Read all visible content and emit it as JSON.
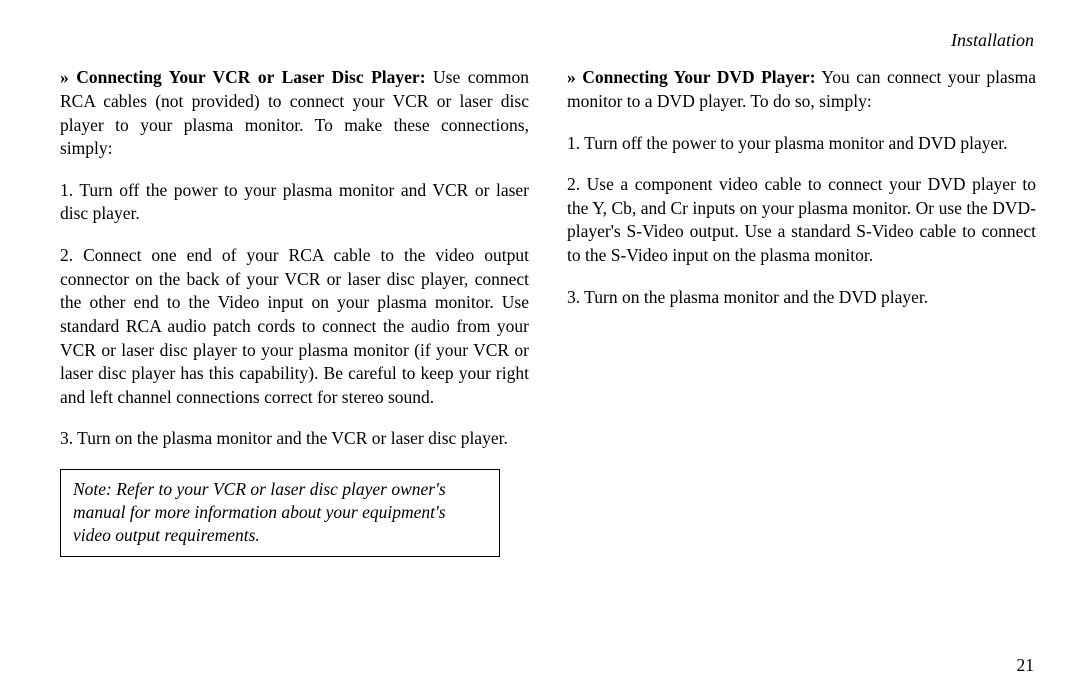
{
  "header": {
    "section": "Installation"
  },
  "left": {
    "heading": "» Connecting Your VCR or Laser Disc Player:",
    "intro": "Use common RCA cables (not provided) to connect your VCR or laser disc player to your plasma monitor. To make these connections, simply:",
    "step1": "1. Turn off the power to your plasma monitor and VCR or laser disc player.",
    "step2": "2. Connect one end of your RCA cable to the video output connector on the back of your VCR or laser disc player, connect the other end to the Video input on your plasma monitor.  Use standard  RCA  audio  patch  cords  to connect the audio from your VCR or laser disc player to your plasma monitor (if your VCR or laser disc player has this capability). Be careful to keep your right and   left channel connections correct for stereo sound.",
    "step3": "3. Turn on the plasma monitor and the VCR or laser disc player.",
    "note": "Note: Refer to your VCR or laser disc player owner's manual for more information about your equipment's video output requirements."
  },
  "right": {
    "heading": "» Connecting Your DVD Player:",
    "intro": "You can connect your plasma monitor to a DVD player. To do so, simply:",
    "step1": "1. Turn off the power to your plasma monitor and DVD player.",
    "step2": "2. Use  a  component  video  cable  to  connect  your  DVD player to  the Y,  Cb,  and  Cr  inputs  on  your  plasma monitor. Or  use the  DVD-player's  S-Video  output.  Use   a standard S-Video cable to connect to the S-Video input on the plasma monitor.",
    "step3": "3. Turn on the plasma monitor and the DVD player."
  },
  "page_number": "21"
}
